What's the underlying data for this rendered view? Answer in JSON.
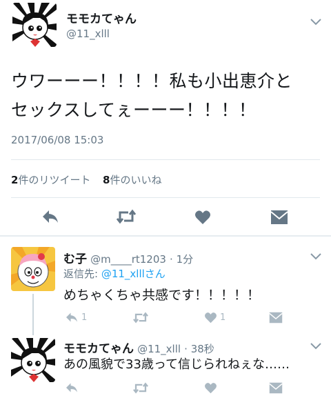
{
  "tweet": {
    "display_name": "モモカてゃん",
    "handle": "@11_xlll",
    "text_line1": "ウワーーー！！！！私も小出恵介と",
    "text_line2": "セックスしてぇーーー！！！！",
    "timestamp": "2017/06/08 15:03",
    "retweets_count": "2",
    "retweets_label": "件のリツイート",
    "likes_count": "8",
    "likes_label": "件のいいね"
  },
  "actions": {
    "icons": [
      "reply-icon",
      "retweet-icon",
      "like-icon",
      "message-icon"
    ]
  },
  "reply1": {
    "display_name": "む子",
    "handle": "@m____rt1203",
    "time": "· 1分",
    "reply_to_label": "返信先:",
    "reply_to_user": "@11_xlllさん",
    "text": "めちゃくちゃ共感です！！！！！",
    "reply_count": "1",
    "like_count": "1"
  },
  "reply2": {
    "display_name": "モモカてゃん",
    "handle": "@11_xlll",
    "time": "· 38秒",
    "text": "あの風貌で33歳って信じられねぇな……"
  },
  "colors": {
    "icon_gray": "#657786",
    "icon_light": "#aab8c2",
    "link_blue": "#1da1f2",
    "divider": "#e1e8ed"
  }
}
